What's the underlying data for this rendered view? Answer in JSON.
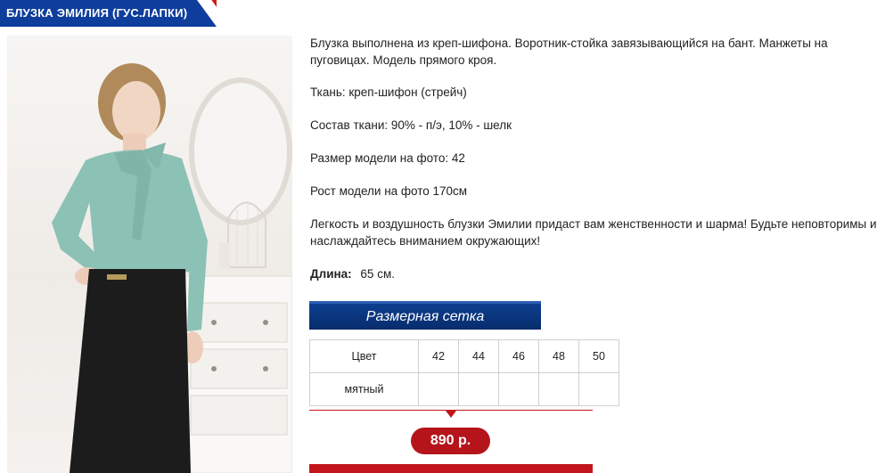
{
  "product": {
    "title": "БЛУЗКА ЭМИЛИЯ (ГУС.ЛАПКИ)"
  },
  "colors": {
    "title_bg": "#0e3d9c",
    "accent_red": "#c4151c",
    "button_blue": "#0d3f8f",
    "blouse": "#8cc1b5",
    "skirt": "#1c1c1c"
  },
  "description": {
    "intro": "Блузка выполнена из креп-шифона. Воротник-стойка завязывающийся на бант. Манжеты на пуговицах. Модель прямого кроя.",
    "fabric": "Ткань: креп-шифон (стрейч)",
    "composition": "Состав ткани: 90% - п/э, 10% - шелк",
    "model_size": "Размер модели на фото: 42",
    "model_height": "Рост модели на фото 170см",
    "promo": "Легкость и воздушность блузки Эмилии придаст вам женственности и шарма! Будьте неповторимы и наслаждайтесь вниманием окружающих!",
    "length_label": "Длина:",
    "length_value": "65 см."
  },
  "size_chart": {
    "button_label": "Размерная сетка",
    "header_label": "Цвет",
    "sizes": [
      "42",
      "44",
      "46",
      "48",
      "50"
    ],
    "color_name": "мятный"
  },
  "price": {
    "value": "890 р."
  },
  "photo_icon": "product-photo-model-in-blouse"
}
